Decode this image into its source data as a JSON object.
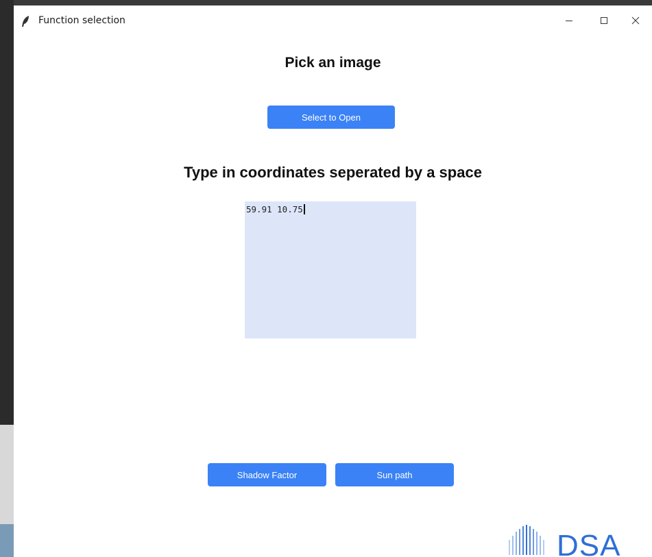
{
  "window": {
    "title": "Function selection",
    "icon": "feather-icon"
  },
  "window_controls": {
    "minimize": "minimize-icon",
    "maximize": "maximize-icon",
    "close": "close-icon"
  },
  "main": {
    "pick_heading": "Pick an image",
    "open_button_label": "Select to Open",
    "coords_heading": "Type in coordinates seperated by a space",
    "coords_value": "59.91 10.75",
    "shadow_button_label": "Shadow Factor",
    "sunpath_button_label": "Sun path"
  },
  "logo": {
    "text": "DSA",
    "icon": "soundwave-logo-icon"
  },
  "colors": {
    "accent": "#3b82f6",
    "input_bg": "#dce6f8",
    "logo": "#2f6fd6"
  }
}
